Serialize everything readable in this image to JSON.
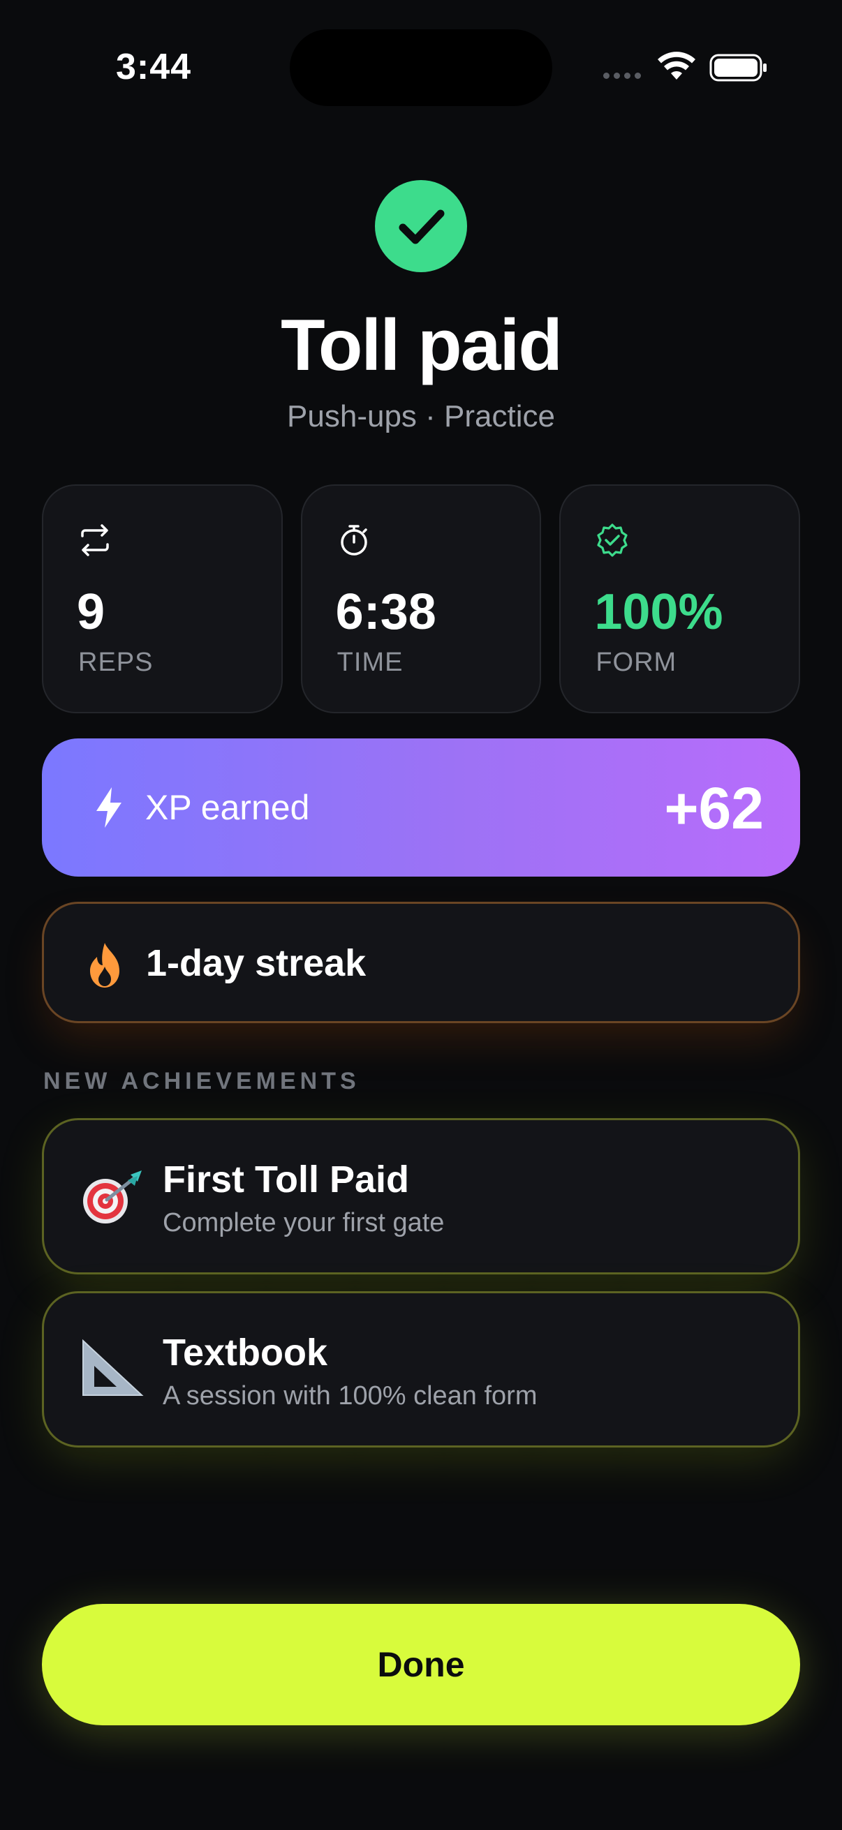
{
  "status_bar": {
    "time": "3:44"
  },
  "header": {
    "title": "Toll paid",
    "subtitle": "Push-ups · Practice"
  },
  "stats": [
    {
      "icon": "repeat-icon",
      "value": "9",
      "label": "REPS"
    },
    {
      "icon": "stopwatch-icon",
      "value": "6:38",
      "label": "TIME"
    },
    {
      "icon": "verified-badge-icon",
      "value": "100%",
      "label": "FORM"
    }
  ],
  "xp": {
    "icon": "lightning-icon",
    "label": "XP earned",
    "value": "+62"
  },
  "streak": {
    "icon": "flame-icon",
    "label": "1-day streak"
  },
  "achievements": {
    "heading": "NEW ACHIEVEMENTS",
    "items": [
      {
        "icon": "target-dart-icon",
        "title": "First Toll Paid",
        "description": "Complete your first gate"
      },
      {
        "icon": "set-square-icon",
        "title": "Textbook",
        "description": "A session with 100% clean form"
      }
    ]
  },
  "done_button": {
    "label": "Done"
  },
  "colors": {
    "accent": "#d8fb3c",
    "success": "#3ddc8c",
    "xp_start": "#7b78ff",
    "xp_end": "#b86cfb",
    "streak": "#ff9a3c"
  }
}
